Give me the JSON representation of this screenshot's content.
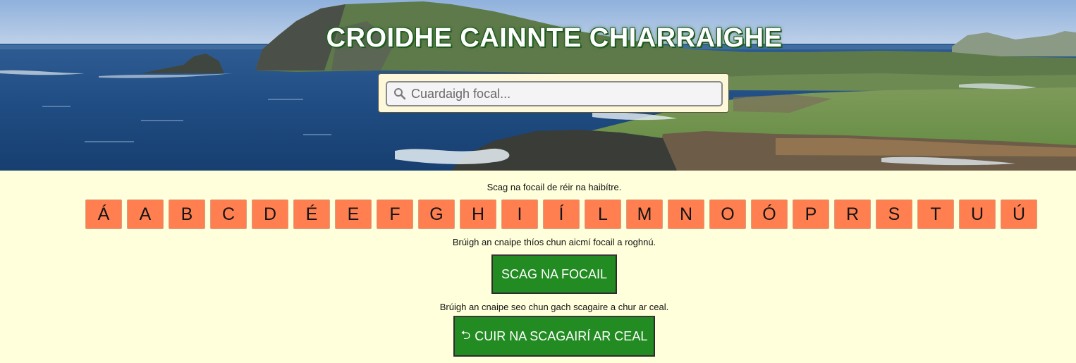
{
  "header": {
    "title": "CROIDHE CAINNTE CHIARRAIGHE"
  },
  "search": {
    "placeholder": "Cuardaigh focal...",
    "icon": "search-icon"
  },
  "filter": {
    "alphabet_hint": "Scag na focail de réir na haibítre.",
    "letters": [
      "Á",
      "A",
      "B",
      "C",
      "D",
      "É",
      "E",
      "F",
      "G",
      "H",
      "I",
      "Í",
      "L",
      "M",
      "N",
      "O",
      "Ó",
      "P",
      "R",
      "S",
      "T",
      "U",
      "Ú"
    ],
    "category_hint": "Brúigh an cnaipe thíos chun aicmí focail a roghnú.",
    "filter_button_label": "SCAG NA FOCAIL",
    "reset_hint": "Brúigh an cnaipe seo chun gach scagaire a chur ar ceal.",
    "reset_button_label": "CUIR NA SCAGAIRÍ AR CEAL",
    "reset_icon": "undo-icon"
  },
  "colors": {
    "page_background": "#ffffdc",
    "letter_button": "#ff7f50",
    "action_button": "#228b22"
  }
}
